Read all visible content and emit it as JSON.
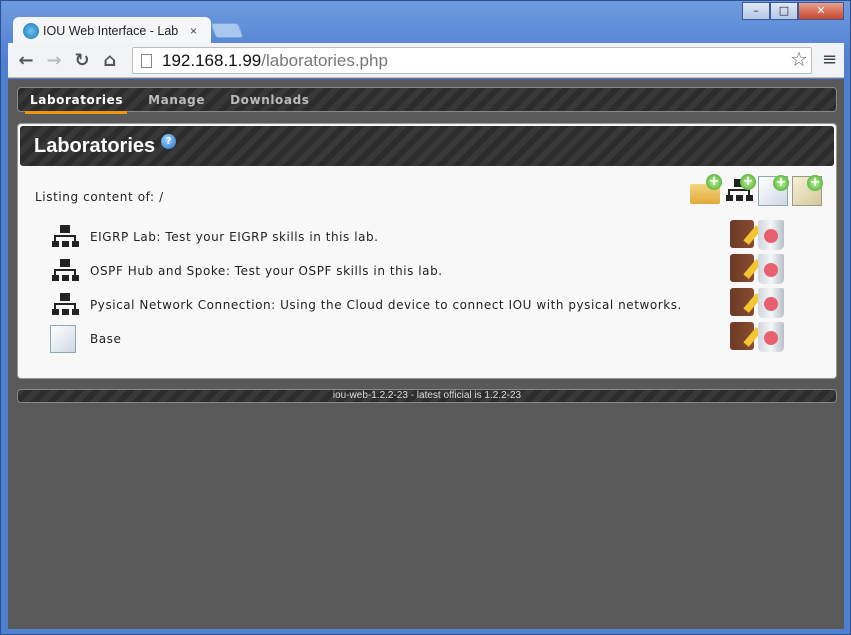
{
  "browser": {
    "tab_title": "IOU Web Interface - Lab",
    "tab_close": "×",
    "url_host": "192.168.1.99",
    "url_path": "/laboratories.php",
    "back": "←",
    "forward": "→",
    "reload": "↻",
    "home": "⌂",
    "star": "☆",
    "menu": "≡",
    "win_min": "–",
    "win_max": "□",
    "win_close": "✕"
  },
  "nav": {
    "items": [
      {
        "label": "Laboratories",
        "active": true
      },
      {
        "label": "Manage"
      },
      {
        "label": "Downloads"
      }
    ]
  },
  "panel": {
    "title": "Laboratories",
    "help": "?",
    "listing": "Listing content of: /"
  },
  "toolbar_icons": [
    "add-folder-icon",
    "add-lab-icon",
    "add-document-icon",
    "import-icon"
  ],
  "rows": [
    {
      "type": "lab",
      "label": "EIGRP Lab: Test your EIGRP skills in this lab."
    },
    {
      "type": "lab",
      "label": "OSPF Hub and Spoke: Test your OSPF skills in this lab."
    },
    {
      "type": "lab",
      "label": "Pysical Network Connection: Using the Cloud device to connect IOU with pysical networks."
    },
    {
      "type": "document",
      "label": "Base"
    }
  ],
  "footer": {
    "text": "iou-web-1.2.2-23 - latest official is 1.2.2-23"
  },
  "colors": {
    "accent": "#f0950c",
    "page_bg": "#595959"
  }
}
